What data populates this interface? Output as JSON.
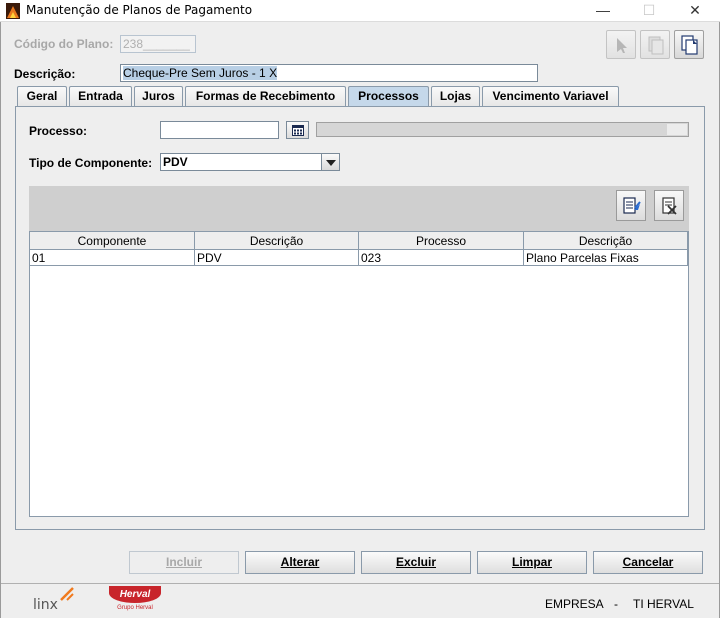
{
  "window": {
    "title": "Manutenção de Planos de Pagamento",
    "minimize": "—",
    "maximize": "☐",
    "close": "✕"
  },
  "form": {
    "codigo_label": "Código do Plano:",
    "codigo_value": "238_______",
    "descricao_label": "Descrição:",
    "descricao_value": "Cheque-Pre Sem Juros - 1 X"
  },
  "tabs": [
    {
      "label": "Geral"
    },
    {
      "label": "Entrada"
    },
    {
      "label": "Juros"
    },
    {
      "label": "Formas de Recebimento"
    },
    {
      "label": "Processos"
    },
    {
      "label": "Lojas"
    },
    {
      "label": "Vencimento Variavel"
    }
  ],
  "active_tab": "Processos",
  "processos": {
    "processo_label": "Processo:",
    "processo_value": "",
    "tipo_label": "Tipo de Componente:",
    "tipo_value": "PDV"
  },
  "grid": {
    "headers": [
      "Componente",
      "Descrição",
      "Processo",
      "Descrição"
    ],
    "rows": [
      [
        "01",
        "PDV",
        "023",
        "Plano Parcelas Fixas"
      ]
    ]
  },
  "actions": {
    "incluir": "Incluir",
    "alterar": "Alterar",
    "excluir": "Excluir",
    "limpar": "Limpar",
    "cancelar": "Cancelar"
  },
  "footer": {
    "logo_linx": "linx",
    "logo_herval": "Herval",
    "logo_herval_sub": "Grupo Herval",
    "empresa": "EMPRESA",
    "separator": "-",
    "empresa_value": "TI HERVAL"
  },
  "colors": {
    "active_tab": "#c5d8ea",
    "selection": "#b8cfe5",
    "herval_red": "#c8252b"
  }
}
